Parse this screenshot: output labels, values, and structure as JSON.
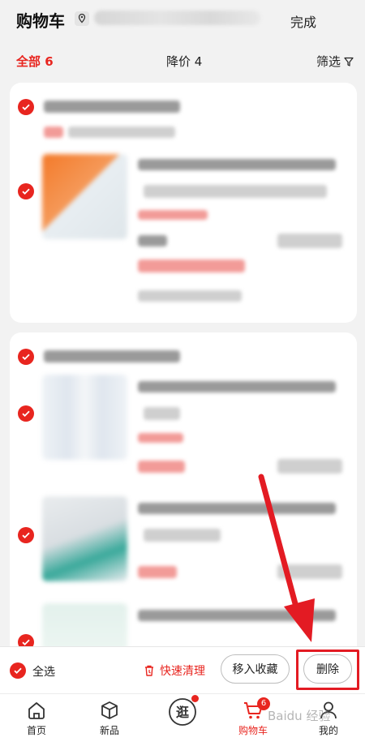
{
  "header": {
    "title": "购物车",
    "done_label": "完成"
  },
  "tabs": {
    "all": "全部 6",
    "price_drop": "降价 4",
    "filter": "筛选"
  },
  "action_bar": {
    "select_all": "全选",
    "quick_clean": "快速清理",
    "move_to_favorites": "移入收藏",
    "delete": "删除"
  },
  "tab_bar": {
    "items": [
      {
        "label": "首页",
        "icon": "home-icon"
      },
      {
        "label": "新品",
        "icon": "box-icon"
      },
      {
        "label": "逛",
        "icon": "browse-icon"
      },
      {
        "label": "购物车",
        "icon": "cart-icon",
        "badge": "6"
      },
      {
        "label": "我的",
        "icon": "user-icon"
      }
    ]
  },
  "watermark": "Baidu 经验",
  "colors": {
    "accent": "#e8251f",
    "annotation": "#e31b23",
    "background": "#f2f2f2"
  }
}
